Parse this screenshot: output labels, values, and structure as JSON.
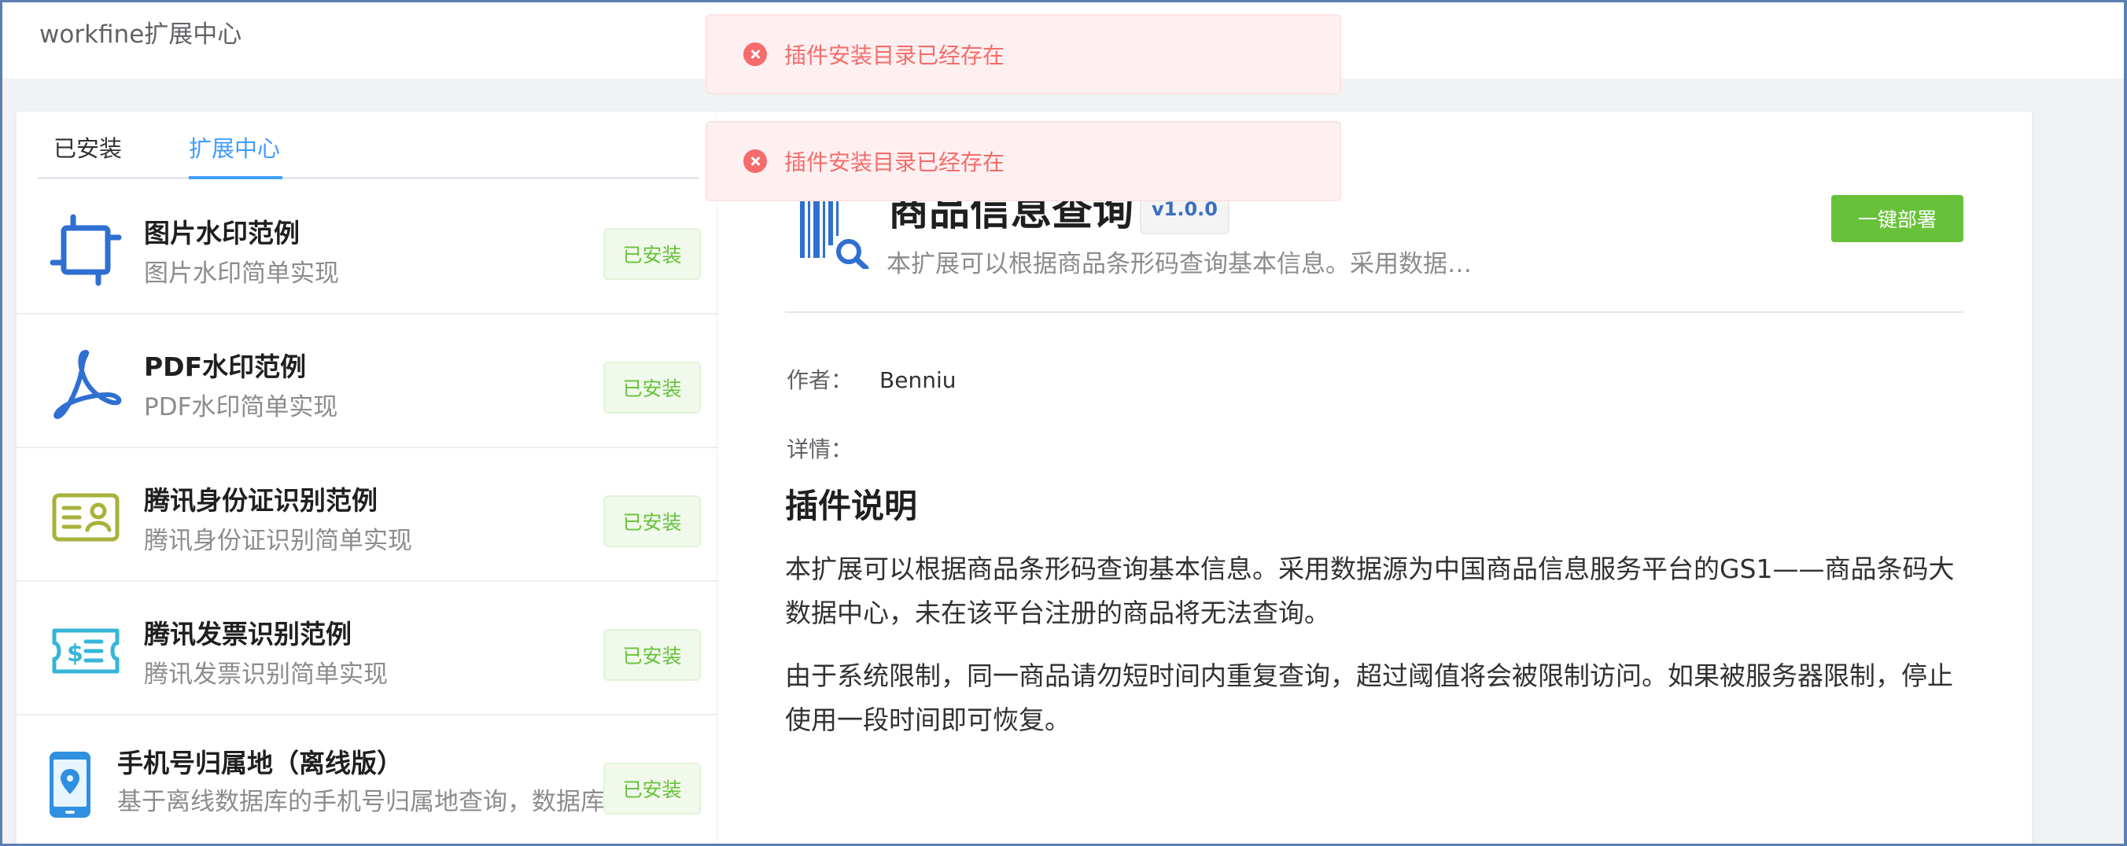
{
  "app": {
    "title": "workfine扩展中心"
  },
  "tabs": [
    {
      "label": "已安装"
    },
    {
      "label": "扩展中心",
      "active": true
    }
  ],
  "extensions": [
    {
      "name": "图片水印范例",
      "desc": "图片水印简单实现",
      "status": "已安装",
      "icon": "crop-frame-icon"
    },
    {
      "name": "PDF水印范例",
      "desc": "PDF水印简单实现",
      "status": "已安装",
      "icon": "pdf-icon"
    },
    {
      "name": "腾讯身份证识别范例",
      "desc": "腾讯身份证识别简单实现",
      "status": "已安装",
      "icon": "id-card-icon"
    },
    {
      "name": "腾讯发票识别范例",
      "desc": "腾讯发票识别简单实现",
      "status": "已安装",
      "icon": "invoice-icon"
    },
    {
      "name": "手机号归属地（离线版）",
      "desc": "基于离线数据库的手机号归属地查询，数据库",
      "status": "已安装",
      "icon": "phone-location-icon"
    }
  ],
  "detail": {
    "title": "商品信息查询",
    "version": "v1.0.0",
    "summary": "本扩展可以根据商品条形码查询基本信息。采用数据…",
    "deploy_label": "一键部署",
    "author_label": "作者：",
    "author": "Benniu",
    "details_label": "详情：",
    "readme_title": "插件说明",
    "readme_paragraphs": [
      "本扩展可以根据商品条形码查询基本信息。采用数据源为中国商品信息服务平台的GS1——商品条码大数据中心，未在该平台注册的商品将无法查询。",
      "由于系统限制，同一商品请勿短时间内重复查询，超过阈值将会被限制访问。如果被服务器限制，停止使用一段时间即可恢复。"
    ],
    "icon": "barcode-search-icon"
  },
  "toasts": [
    {
      "message": "插件安装目录已经存在",
      "type": "error"
    },
    {
      "message": "插件安装目录已经存在",
      "type": "error"
    }
  ],
  "colors": {
    "primary": "#409eff",
    "success": "#67c23a",
    "error": "#f56c6c",
    "icon_blue": "#2f6fd1",
    "icon_olive": "#a8b23a",
    "icon_cyan": "#35b6d8"
  }
}
